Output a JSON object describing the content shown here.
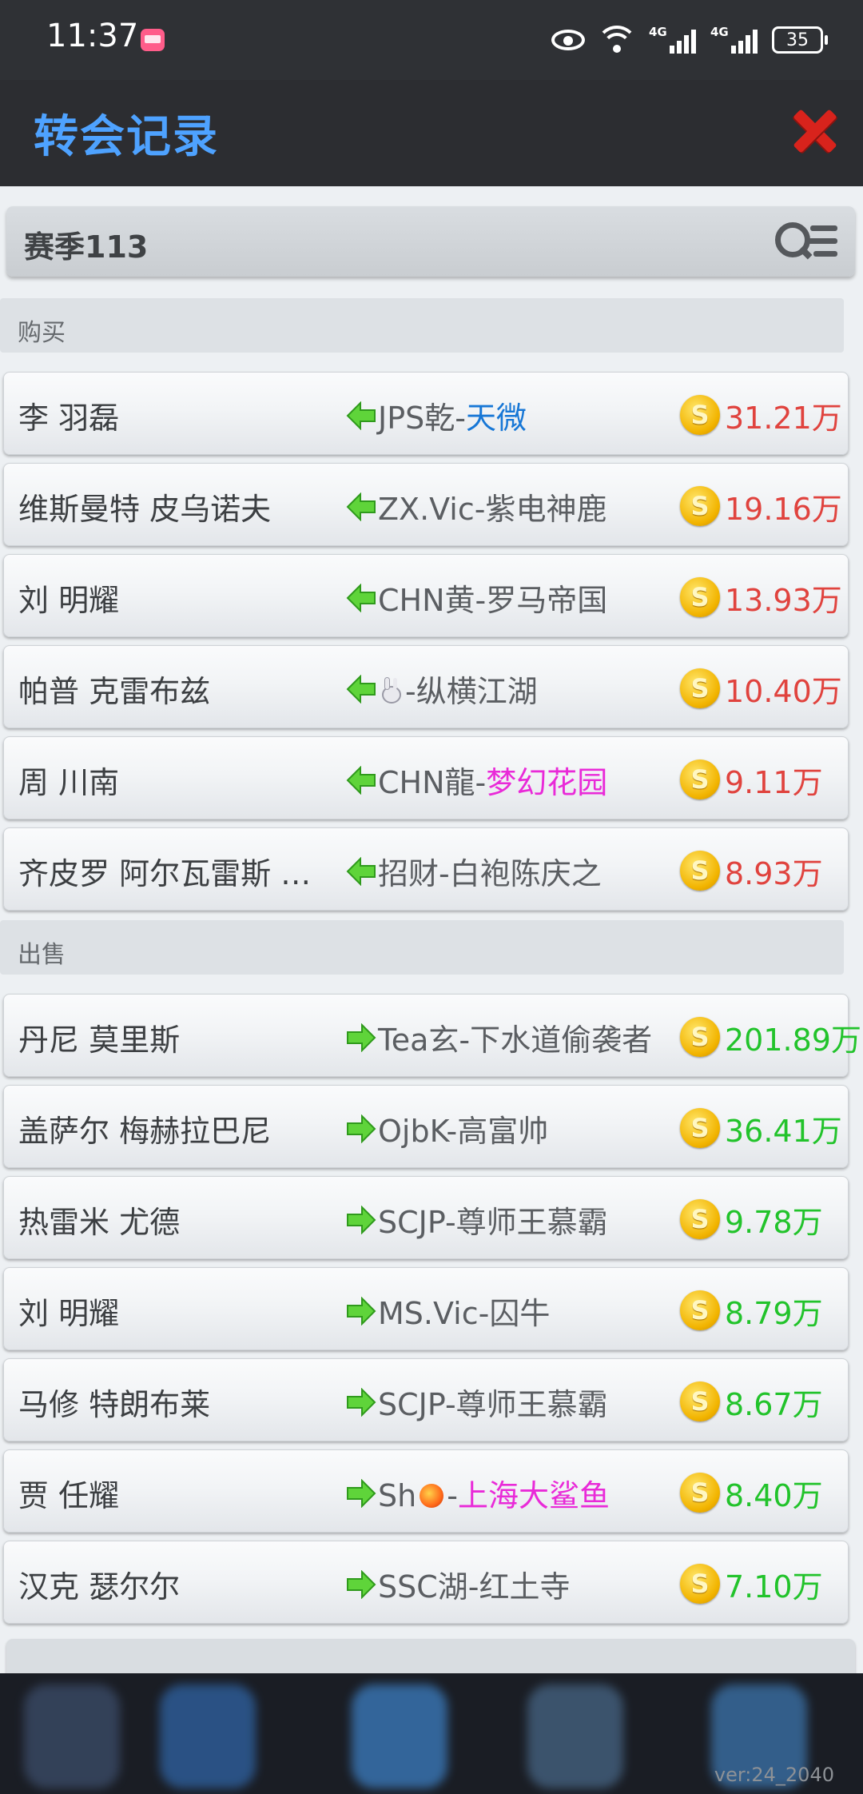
{
  "status_bar": {
    "time": "11:37",
    "network_labels": [
      "4G",
      "4G"
    ],
    "battery": "35",
    "icons": [
      "app-badge-icon",
      "eye-icon",
      "wifi-icon",
      "signal-4g-icon",
      "signal-4g-icon",
      "battery-icon"
    ]
  },
  "header": {
    "title": "转会记录",
    "close_icon": "close-icon",
    "colors": {
      "title": "#4ea2ff",
      "close": "#d8231c"
    }
  },
  "season": {
    "label": "赛季113",
    "filter_icon": "search-filter-icon"
  },
  "sections": {
    "buy": {
      "title": "购买",
      "direction_icon": "arrow-left-icon",
      "price_color": "#e0433e",
      "rows": [
        {
          "player": "李 羽磊",
          "club_prefix": "JPS乾-",
          "club_name": "天微",
          "price": "31.21万"
        },
        {
          "player": "维斯曼特 皮乌诺夫",
          "club_prefix": "ZX.Vic-",
          "club_name": "紫电神鹿",
          "price": "19.16万"
        },
        {
          "player": "刘 明耀",
          "club_prefix": "CHN黄-",
          "club_name": "罗马帝国",
          "price": "13.93万"
        },
        {
          "player": "帕普 克雷布兹",
          "club_prefix": "-",
          "club_name": "纵横江湖",
          "price": "10.40万"
        },
        {
          "player": "周 川南",
          "club_prefix": "CHN龍-",
          "club_name": "梦幻花园",
          "price": "9.11万"
        },
        {
          "player": "齐皮罗 阿尔瓦雷斯 卡...",
          "club_prefix": "招财-",
          "club_name": "白袍陈庆之",
          "price": "8.93万"
        }
      ]
    },
    "sell": {
      "title": "出售",
      "direction_icon": "arrow-right-icon",
      "price_color": "#22c32b",
      "rows": [
        {
          "player": "丹尼 莫里斯",
          "club_prefix": "Tea玄-",
          "club_name": "下水道偷袭者",
          "price": "201.89万"
        },
        {
          "player": "盖萨尔 梅赫拉巴尼",
          "club_prefix": "OjbK-",
          "club_name": "高富帅",
          "price": "36.41万"
        },
        {
          "player": "热雷米 尤德",
          "club_prefix": "SCJP-",
          "club_name": "尊师王慕霸",
          "price": "9.78万"
        },
        {
          "player": "刘 明耀",
          "club_prefix": "MS.Vic-",
          "club_name": "囚牛",
          "price": "8.79万"
        },
        {
          "player": "马修 特朗布莱",
          "club_prefix": "SCJP-",
          "club_name": "尊师王慕霸",
          "price": "8.67万"
        },
        {
          "player": "贾 任耀",
          "club_prefix": "Sh",
          "club_suffix": "-",
          "club_name": "上海大鲨鱼",
          "price": "8.40万"
        },
        {
          "player": "汉克 瑟尔尔",
          "club_prefix": "SSC湖-",
          "club_name": "红土寺",
          "price": "7.10万"
        }
      ]
    }
  },
  "coin": {
    "symbol": "S",
    "icon": "coin-icon"
  },
  "footer": {
    "version": "ver:24_2040"
  }
}
